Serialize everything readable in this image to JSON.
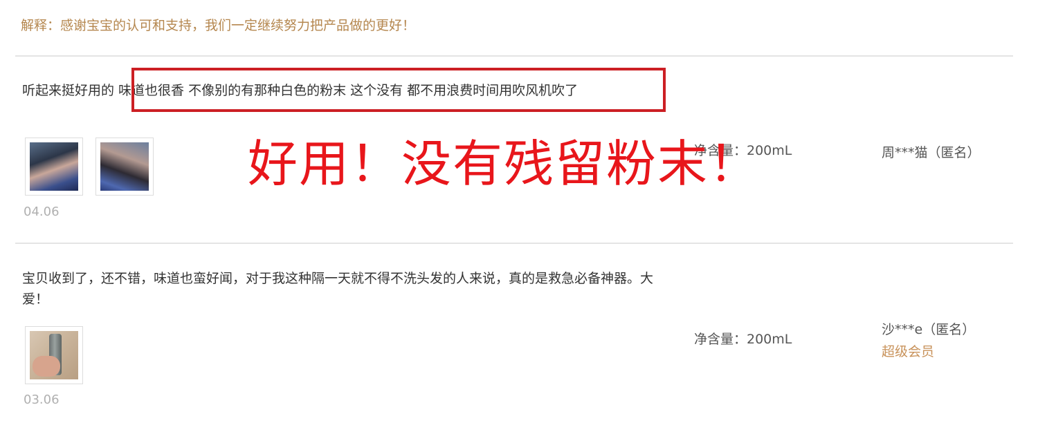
{
  "previous_review": {
    "reply": "解释：感谢宝宝的认可和支持，我们一定继续努力把产品做的更好！"
  },
  "reviews": [
    {
      "text": "听起来挺好用的 味道也很香 不像别的有那种白色的粉末 这个没有 都不用浪费时间用吹风机吹了",
      "date": "04.06",
      "spec": "净含量：200mL",
      "user": "周***猫（匿名）",
      "images": [
        "photo-1",
        "photo-2"
      ]
    },
    {
      "text": "宝贝收到了，还不错，味道也蛮好闻，对于我这种隔一天就不得不洗头发的人来说，真的是救急必备神器。大爱！",
      "date": "03.06",
      "spec": "净含量：200mL",
      "user": "沙***e（匿名）",
      "badge": "超级会员",
      "images": [
        "photo-1"
      ]
    }
  ],
  "annotation": {
    "callout": "好用！没有残留粉末！"
  },
  "colors": {
    "reply_text": "#b5874f",
    "annotation_red": "#e8161b",
    "box_border": "#cc1f24",
    "badge": "#c8925a"
  }
}
